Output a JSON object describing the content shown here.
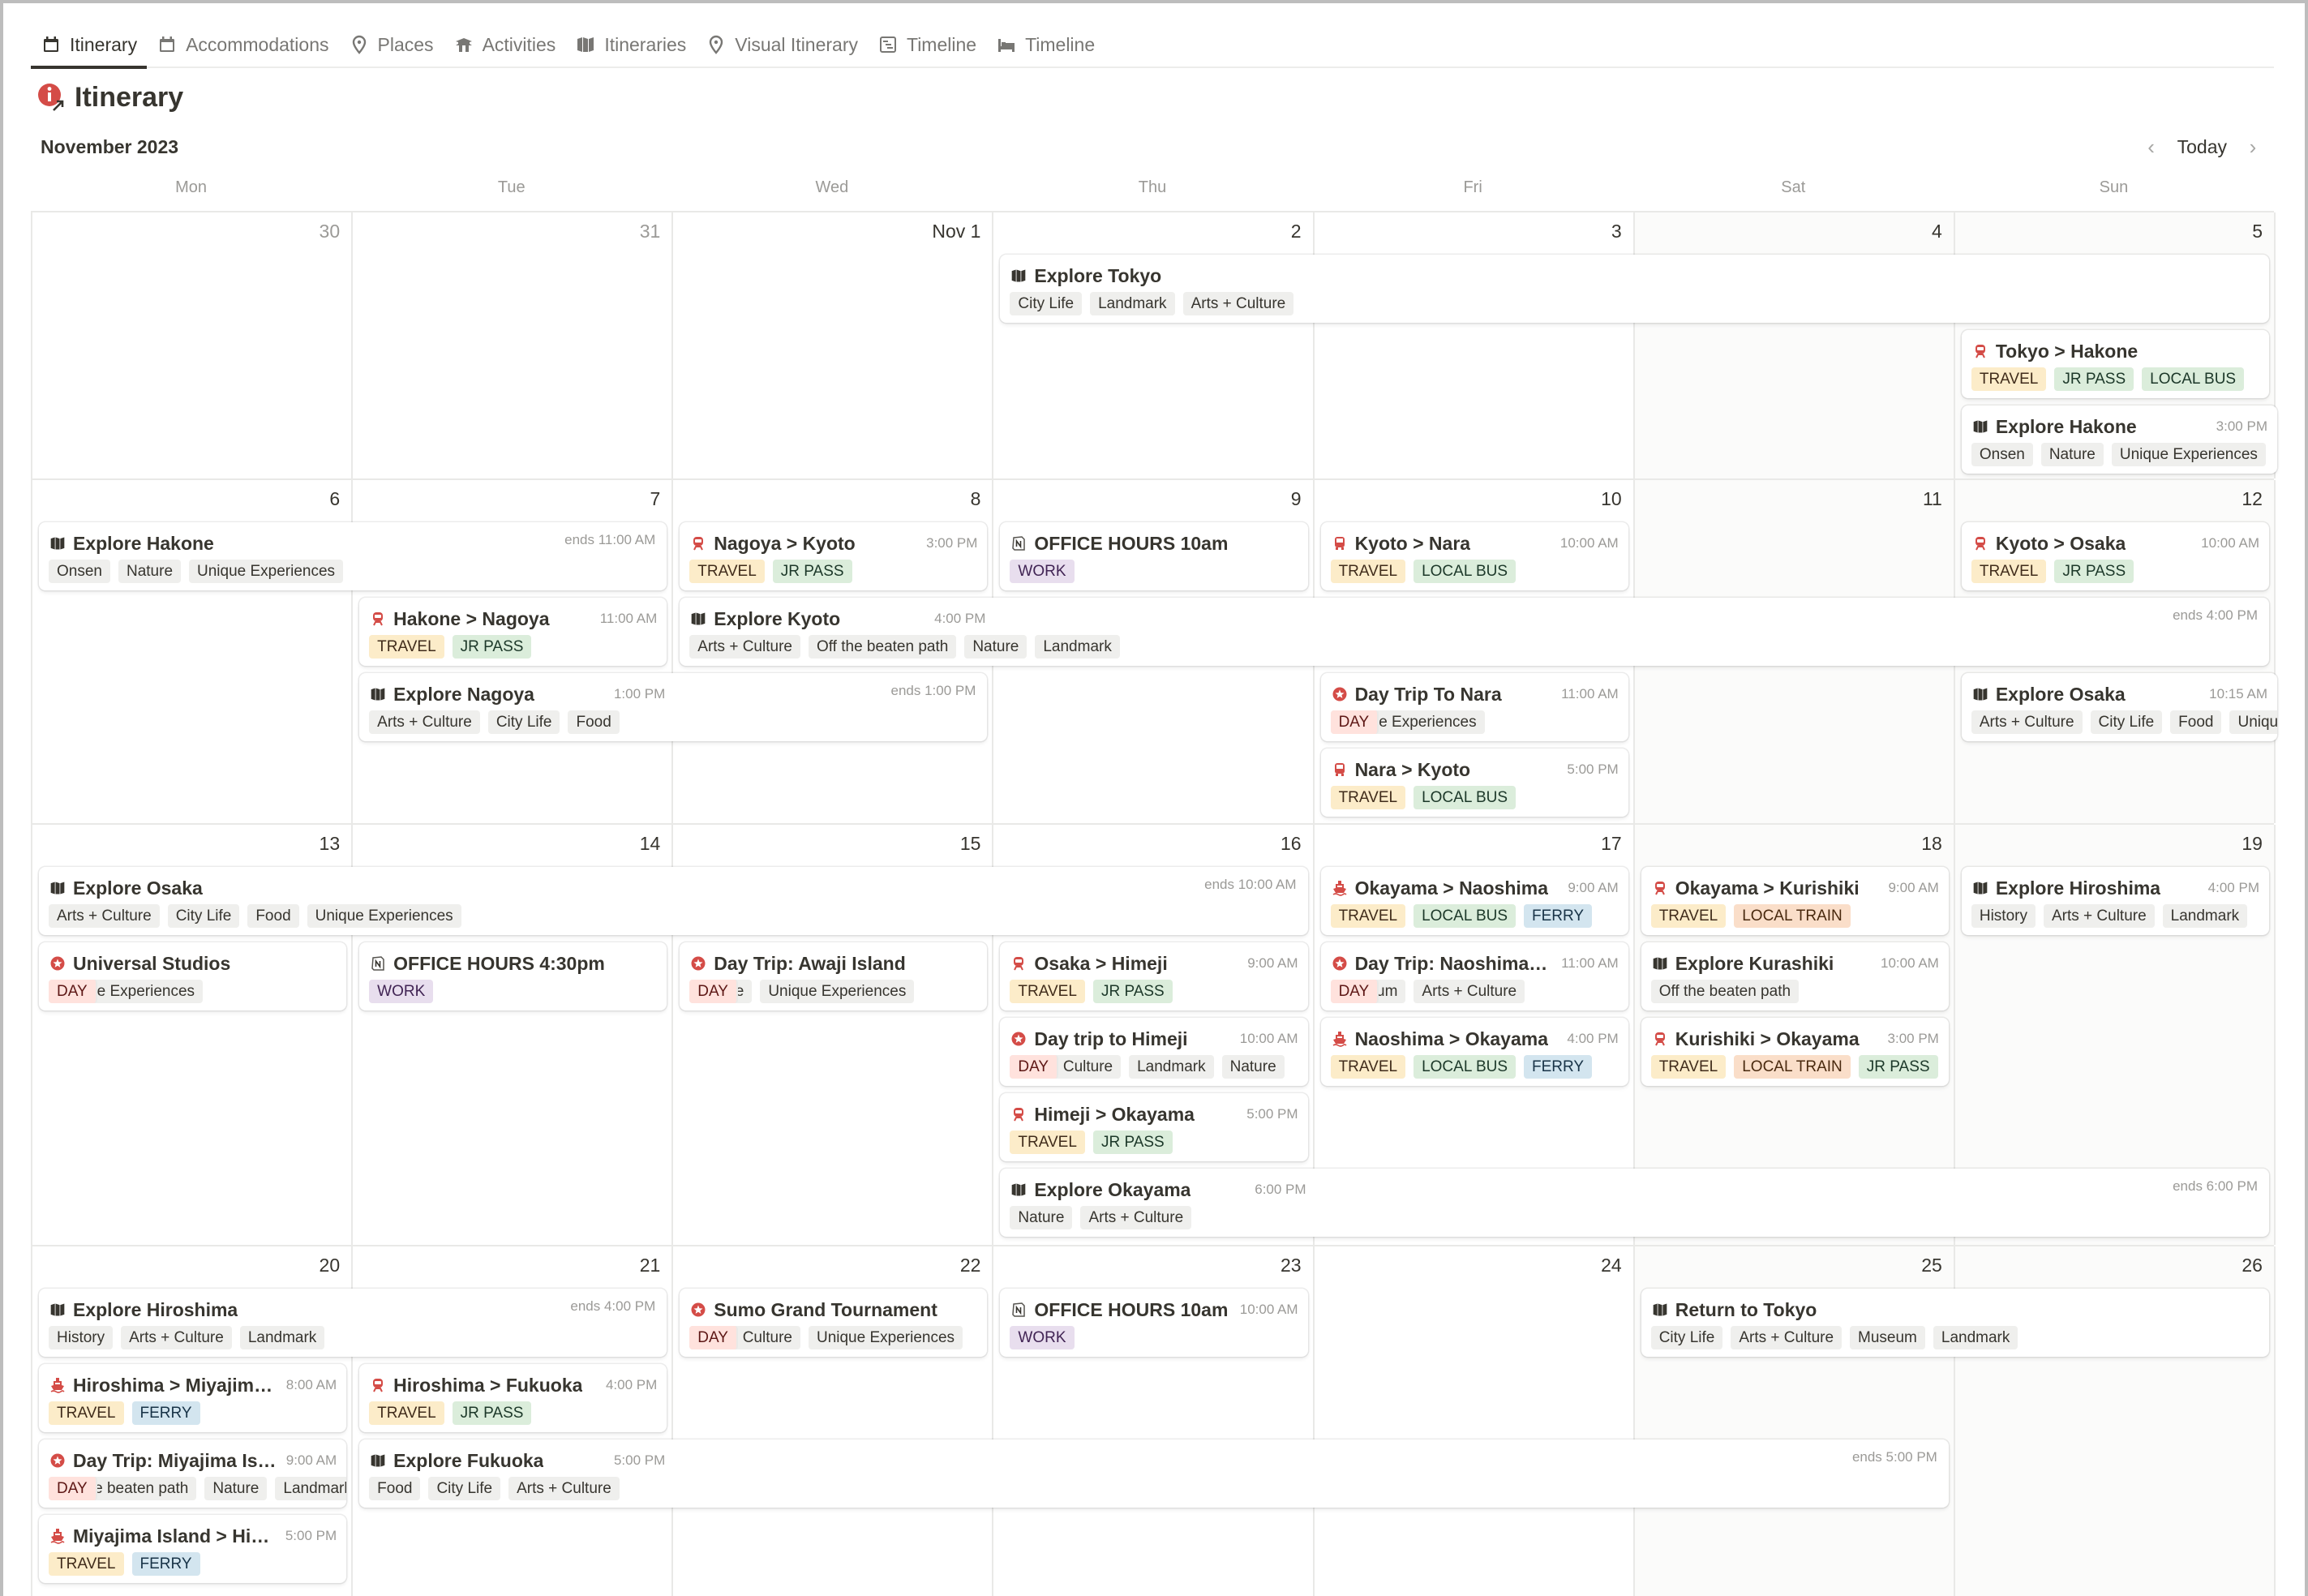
{
  "tabs": [
    {
      "label": "Itinerary",
      "icon": "calendar-icon",
      "active": true
    },
    {
      "label": "Accommodations",
      "icon": "calendar-icon",
      "active": false
    },
    {
      "label": "Places",
      "icon": "map-pin-icon",
      "active": false
    },
    {
      "label": "Activities",
      "icon": "pagoda-icon",
      "active": false
    },
    {
      "label": "Itineraries",
      "icon": "map-icon",
      "active": false
    },
    {
      "label": "Visual Itinerary",
      "icon": "map-pin-icon",
      "active": false
    },
    {
      "label": "Timeline",
      "icon": "timeline-icon",
      "active": false
    },
    {
      "label": "Timeline",
      "icon": "bed-icon",
      "active": false
    }
  ],
  "page": {
    "title": "Itinerary",
    "title_icon": "info-link-icon"
  },
  "calendar": {
    "month_label": "November 2023",
    "today_label": "Today",
    "prev_icon": "chevron-left-icon",
    "next_icon": "chevron-right-icon",
    "weekdays": [
      "Mon",
      "Tue",
      "Wed",
      "Thu",
      "Fri",
      "Sat",
      "Sun"
    ],
    "weeks": [
      {
        "days": [
          {
            "label": "30",
            "muted": true
          },
          {
            "label": "31",
            "muted": true
          },
          {
            "label": "Nov 1"
          },
          {
            "label": "2"
          },
          {
            "label": "3"
          },
          {
            "label": "4"
          },
          {
            "label": "5"
          }
        ],
        "events": [
          {
            "title": "Explore Tokyo",
            "icon": "map-icon",
            "start": 3,
            "span": 4,
            "lane": 0,
            "time": "",
            "ends": "",
            "tags": [
              {
                "t": "City Life"
              },
              {
                "t": "Landmark"
              },
              {
                "t": "Arts + Culture"
              }
            ]
          },
          {
            "title": "Tokyo > Hakone",
            "icon": "train-icon",
            "start": 6,
            "span": 1,
            "lane": 1,
            "time": "",
            "tags": [
              {
                "t": "TRAVEL",
                "c": "travel"
              },
              {
                "t": "JR PASS",
                "c": "jr"
              },
              {
                "t": "LOCAL BUS",
                "c": "bus"
              }
            ]
          },
          {
            "title": "Explore Hakone",
            "icon": "map-icon",
            "start": 6,
            "span": 1,
            "lane": 2,
            "time": "3:00 PM",
            "overflow": true,
            "tags": [
              {
                "t": "Onsen"
              },
              {
                "t": "Nature"
              },
              {
                "t": "Unique Experiences"
              }
            ]
          }
        ]
      },
      {
        "days": [
          {
            "label": "6"
          },
          {
            "label": "7"
          },
          {
            "label": "8"
          },
          {
            "label": "9"
          },
          {
            "label": "10"
          },
          {
            "label": "11"
          },
          {
            "label": "12"
          }
        ],
        "events": [
          {
            "title": "Explore Hakone",
            "icon": "map-icon",
            "start": 0,
            "span": 2,
            "lane": 0,
            "ends": "ends 11:00 AM",
            "tags": [
              {
                "t": "Onsen"
              },
              {
                "t": "Nature"
              },
              {
                "t": "Unique Experiences"
              }
            ]
          },
          {
            "title": "Nagoya > Kyoto",
            "icon": "train-icon",
            "start": 2,
            "span": 1,
            "lane": 0,
            "time": "3:00 PM",
            "tags": [
              {
                "t": "TRAVEL",
                "c": "travel"
              },
              {
                "t": "JR PASS",
                "c": "jr"
              }
            ]
          },
          {
            "title": "OFFICE HOURS 10am",
            "icon": "notion-icon",
            "start": 3,
            "span": 1,
            "lane": 0,
            "tags": [
              {
                "t": "WORK",
                "c": "work"
              }
            ]
          },
          {
            "title": "Kyoto > Nara",
            "icon": "bus-icon",
            "start": 4,
            "span": 1,
            "lane": 0,
            "time": "10:00 AM",
            "tags": [
              {
                "t": "TRAVEL",
                "c": "travel"
              },
              {
                "t": "LOCAL BUS",
                "c": "bus"
              }
            ]
          },
          {
            "title": "Kyoto > Osaka",
            "icon": "train-icon",
            "start": 6,
            "span": 1,
            "lane": 0,
            "time": "10:00 AM",
            "tags": [
              {
                "t": "TRAVEL",
                "c": "travel"
              },
              {
                "t": "JR PASS",
                "c": "jr"
              }
            ]
          },
          {
            "title": "Hakone > Nagoya",
            "icon": "train-icon",
            "start": 1,
            "span": 1,
            "lane": 1,
            "time": "11:00 AM",
            "tags": [
              {
                "t": "TRAVEL",
                "c": "travel"
              },
              {
                "t": "JR PASS",
                "c": "jr"
              }
            ]
          },
          {
            "title": "Explore Kyoto",
            "icon": "map-icon",
            "start": 2,
            "span": 5,
            "lane": 1,
            "time": "4:00 PM",
            "ends": "ends 4:00 PM",
            "tags": [
              {
                "t": "Arts + Culture"
              },
              {
                "t": "Off the beaten path"
              },
              {
                "t": "Nature"
              },
              {
                "t": "Landmark"
              }
            ]
          },
          {
            "title": "Explore Nagoya",
            "icon": "map-icon",
            "start": 1,
            "span": 2,
            "lane": 2,
            "time": "1:00 PM",
            "ends": "ends 1:00 PM",
            "tags": [
              {
                "t": "Arts + Culture"
              },
              {
                "t": "City Life"
              },
              {
                "t": "Food"
              }
            ]
          },
          {
            "title": "Day Trip To Nara",
            "icon": "star-badge-icon",
            "start": 4,
            "span": 1,
            "lane": 2,
            "time": "11:00 AM",
            "tags": [
              {
                "t": "DAY",
                "c": "day"
              },
              {
                "t": "Unique Experiences"
              }
            ]
          },
          {
            "title": "Explore Osaka",
            "icon": "map-icon",
            "start": 6,
            "span": 1,
            "lane": 2,
            "time": "10:15 AM",
            "overflow": true,
            "tags": [
              {
                "t": "Arts + Culture"
              },
              {
                "t": "City Life"
              },
              {
                "t": "Food"
              },
              {
                "t": "Unique Experiences"
              }
            ]
          },
          {
            "title": "Nara > Kyoto",
            "icon": "bus-icon",
            "start": 4,
            "span": 1,
            "lane": 3,
            "time": "5:00 PM",
            "tags": [
              {
                "t": "TRAVEL",
                "c": "travel"
              },
              {
                "t": "LOCAL BUS",
                "c": "bus"
              }
            ]
          }
        ]
      },
      {
        "days": [
          {
            "label": "13"
          },
          {
            "label": "14"
          },
          {
            "label": "15"
          },
          {
            "label": "16"
          },
          {
            "label": "17"
          },
          {
            "label": "18"
          },
          {
            "label": "19"
          }
        ],
        "events": [
          {
            "title": "Explore Osaka",
            "icon": "map-icon",
            "start": 0,
            "span": 4,
            "lane": 0,
            "ends": "ends 10:00 AM",
            "tags": [
              {
                "t": "Arts + Culture"
              },
              {
                "t": "City Life"
              },
              {
                "t": "Food"
              },
              {
                "t": "Unique Experiences"
              }
            ]
          },
          {
            "title": "Okayama > Naoshima",
            "icon": "ferry-icon",
            "start": 4,
            "span": 1,
            "lane": 0,
            "time": "9:00 AM",
            "tags": [
              {
                "t": "TRAVEL",
                "c": "travel"
              },
              {
                "t": "LOCAL BUS",
                "c": "bus"
              },
              {
                "t": "FERRY",
                "c": "ferry"
              }
            ]
          },
          {
            "title": "Okayama > Kurishiki",
            "icon": "train-icon",
            "start": 5,
            "span": 1,
            "lane": 0,
            "time": "9:00 AM",
            "tags": [
              {
                "t": "TRAVEL",
                "c": "travel"
              },
              {
                "t": "LOCAL TRAIN",
                "c": "train"
              }
            ]
          },
          {
            "title": "Explore Hiroshima",
            "icon": "map-icon",
            "start": 6,
            "span": 1,
            "lane": 0,
            "time": "4:00 PM",
            "tags": [
              {
                "t": "History"
              },
              {
                "t": "Arts + Culture"
              },
              {
                "t": "Landmark"
              }
            ]
          },
          {
            "title": "Universal Studios",
            "icon": "star-badge-icon",
            "start": 0,
            "span": 1,
            "lane": 1,
            "tags": [
              {
                "t": "DAY",
                "c": "day"
              },
              {
                "t": "Unique Experiences"
              }
            ]
          },
          {
            "title": "OFFICE HOURS 4:30pm",
            "icon": "notion-icon",
            "start": 1,
            "span": 1,
            "lane": 1,
            "tags": [
              {
                "t": "WORK",
                "c": "work"
              }
            ]
          },
          {
            "title": "Day Trip: Awaji Island",
            "icon": "star-badge-icon",
            "start": 2,
            "span": 1,
            "lane": 1,
            "tags": [
              {
                "t": "DAY",
                "c": "day"
              },
              {
                "t": "Nature"
              },
              {
                "t": "Unique Experiences"
              }
            ]
          },
          {
            "title": "Osaka > Himeji",
            "icon": "train-icon",
            "start": 3,
            "span": 1,
            "lane": 1,
            "time": "9:00 AM",
            "tags": [
              {
                "t": "TRAVEL",
                "c": "travel"
              },
              {
                "t": "JR PASS",
                "c": "jr"
              }
            ]
          },
          {
            "title": "Day Trip: Naoshima I...",
            "icon": "star-badge-icon",
            "start": 4,
            "span": 1,
            "lane": 1,
            "time": "11:00 AM",
            "tags": [
              {
                "t": "DAY",
                "c": "day"
              },
              {
                "t": "Museum"
              },
              {
                "t": "Arts + Culture"
              }
            ]
          },
          {
            "title": "Explore Kurashiki",
            "icon": "map-icon",
            "start": 5,
            "span": 1,
            "lane": 1,
            "time": "10:00 AM",
            "tags": [
              {
                "t": "Off the beaten path"
              }
            ]
          },
          {
            "title": "Day trip to Himeji",
            "icon": "star-badge-icon",
            "start": 3,
            "span": 1,
            "lane": 2,
            "time": "10:00 AM",
            "tags": [
              {
                "t": "DAY",
                "c": "day"
              },
              {
                "t": "Arts + Culture"
              },
              {
                "t": "Landmark"
              },
              {
                "t": "Nature"
              }
            ]
          },
          {
            "title": "Naoshima > Okayama",
            "icon": "ferry-icon",
            "start": 4,
            "span": 1,
            "lane": 2,
            "time": "4:00 PM",
            "tags": [
              {
                "t": "TRAVEL",
                "c": "travel"
              },
              {
                "t": "LOCAL BUS",
                "c": "bus"
              },
              {
                "t": "FERRY",
                "c": "ferry"
              }
            ]
          },
          {
            "title": "Kurishiki > Okayama",
            "icon": "train-icon",
            "start": 5,
            "span": 1,
            "lane": 2,
            "time": "3:00 PM",
            "tags": [
              {
                "t": "TRAVEL",
                "c": "travel"
              },
              {
                "t": "LOCAL TRAIN",
                "c": "train"
              },
              {
                "t": "JR PASS",
                "c": "jr"
              }
            ]
          },
          {
            "title": "Himeji > Okayama",
            "icon": "train-icon",
            "start": 3,
            "span": 1,
            "lane": 3,
            "time": "5:00 PM",
            "tags": [
              {
                "t": "TRAVEL",
                "c": "travel"
              },
              {
                "t": "JR PASS",
                "c": "jr"
              }
            ]
          },
          {
            "title": "Explore Okayama",
            "icon": "map-icon",
            "start": 3,
            "span": 4,
            "lane": 4,
            "time": "6:00 PM",
            "ends": "ends 6:00 PM",
            "tags": [
              {
                "t": "Nature"
              },
              {
                "t": "Arts + Culture"
              }
            ]
          }
        ]
      },
      {
        "days": [
          {
            "label": "20"
          },
          {
            "label": "21"
          },
          {
            "label": "22"
          },
          {
            "label": "23"
          },
          {
            "label": "24"
          },
          {
            "label": "25"
          },
          {
            "label": "26"
          }
        ],
        "events": [
          {
            "title": "Explore Hiroshima",
            "icon": "map-icon",
            "start": 0,
            "span": 2,
            "lane": 0,
            "ends": "ends 4:00 PM",
            "tags": [
              {
                "t": "History"
              },
              {
                "t": "Arts + Culture"
              },
              {
                "t": "Landmark"
              }
            ]
          },
          {
            "title": "Sumo Grand Tournament",
            "icon": "star-badge-icon",
            "start": 2,
            "span": 1,
            "lane": 0,
            "tags": [
              {
                "t": "DAY",
                "c": "day"
              },
              {
                "t": "Arts + Culture"
              },
              {
                "t": "Unique Experiences"
              }
            ]
          },
          {
            "title": "OFFICE HOURS 10am",
            "icon": "notion-icon",
            "start": 3,
            "span": 1,
            "lane": 0,
            "time": "10:00 AM",
            "tags": [
              {
                "t": "WORK",
                "c": "work"
              }
            ]
          },
          {
            "title": "Return to Tokyo",
            "icon": "map-icon",
            "start": 5,
            "span": 2,
            "lane": 0,
            "tags": [
              {
                "t": "City Life"
              },
              {
                "t": "Arts + Culture"
              },
              {
                "t": "Museum"
              },
              {
                "t": "Landmark"
              }
            ]
          },
          {
            "title": "Hiroshima > Miyajima...",
            "icon": "ferry-icon",
            "start": 0,
            "span": 1,
            "lane": 1,
            "time": "8:00 AM",
            "tags": [
              {
                "t": "TRAVEL",
                "c": "travel"
              },
              {
                "t": "FERRY",
                "c": "ferry"
              }
            ]
          },
          {
            "title": "Hiroshima > Fukuoka",
            "icon": "train-icon",
            "start": 1,
            "span": 1,
            "lane": 1,
            "time": "4:00 PM",
            "tags": [
              {
                "t": "TRAVEL",
                "c": "travel"
              },
              {
                "t": "JR PASS",
                "c": "jr"
              }
            ]
          },
          {
            "title": "Day Trip: Miyajima Isl...",
            "icon": "star-badge-icon",
            "start": 0,
            "span": 1,
            "lane": 2,
            "time": "9:00 AM",
            "tags": [
              {
                "t": "DAY",
                "c": "day"
              },
              {
                "t": "Off the beaten path"
              },
              {
                "t": "Nature"
              },
              {
                "t": "Landmark"
              }
            ]
          },
          {
            "title": "Explore Fukuoka",
            "icon": "map-icon",
            "start": 1,
            "span": 5,
            "lane": 2,
            "time": "5:00 PM",
            "ends": "ends 5:00 PM",
            "tags": [
              {
                "t": "Food"
              },
              {
                "t": "City Life"
              },
              {
                "t": "Arts + Culture"
              }
            ]
          },
          {
            "title": "Miyajima Island > Hiro...",
            "icon": "ferry-icon",
            "start": 0,
            "span": 1,
            "lane": 3,
            "time": "5:00 PM",
            "tags": [
              {
                "t": "TRAVEL",
                "c": "travel"
              },
              {
                "t": "FERRY",
                "c": "ferry"
              }
            ]
          }
        ]
      }
    ]
  },
  "colors": {
    "accent_red": "#d44c47",
    "text": "#37352f",
    "muted": "#9b9a97"
  }
}
